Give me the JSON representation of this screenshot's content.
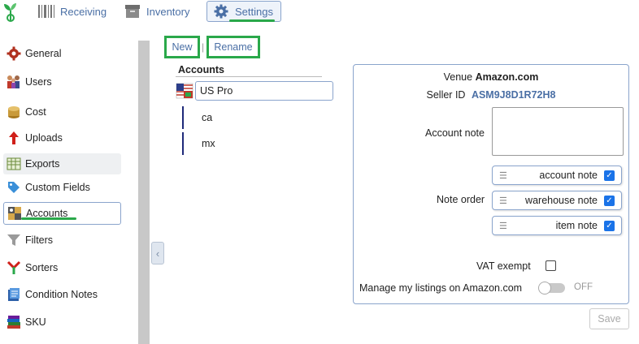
{
  "topnav": {
    "receiving": "Receiving",
    "inventory": "Inventory",
    "settings": "Settings"
  },
  "sidebar": {
    "items": [
      {
        "label": "General",
        "icon": "gear-icon"
      },
      {
        "label": "Users",
        "icon": "users-icon"
      },
      {
        "label": "Cost",
        "icon": "coins-icon"
      },
      {
        "label": "Uploads",
        "icon": "upload-arrow-icon"
      },
      {
        "label": "Exports",
        "icon": "spreadsheet-icon"
      },
      {
        "label": "Custom Fields",
        "icon": "tag-icon"
      },
      {
        "label": "Accounts",
        "icon": "accounts-icon"
      },
      {
        "label": "Filters",
        "icon": "funnel-icon"
      },
      {
        "label": "Sorters",
        "icon": "sort-icon"
      },
      {
        "label": "Condition Notes",
        "icon": "notepad-icon"
      },
      {
        "label": "SKU",
        "icon": "books-icon"
      }
    ],
    "selected": "Accounts"
  },
  "toolbar": {
    "new_label": "New",
    "separator": "|",
    "rename_label": "Rename"
  },
  "accounts": {
    "title": "Accounts",
    "root": {
      "label": "US Pro",
      "icon": "us-flag-icon"
    },
    "children": [
      "ca",
      "mx"
    ]
  },
  "detail": {
    "venue_label": "Venue",
    "venue_value": "Amazon.com",
    "seller_label": "Seller ID",
    "seller_value": "ASM9J8D1R72H8",
    "account_note_label": "Account note",
    "account_note_value": "",
    "note_order_label": "Note order",
    "note_order": [
      {
        "label": "account note",
        "checked": true
      },
      {
        "label": "warehouse note",
        "checked": true
      },
      {
        "label": "item note",
        "checked": true
      }
    ],
    "vat_label": "VAT exempt",
    "vat_checked": false,
    "manage_label": "Manage my listings on Amazon.com",
    "manage_state": "OFF"
  },
  "save_label": "Save",
  "colors": {
    "link": "#4a6fa5",
    "highlight": "#2aa84a",
    "border": "#8aa4cc",
    "checkbox": "#1a73e8"
  }
}
